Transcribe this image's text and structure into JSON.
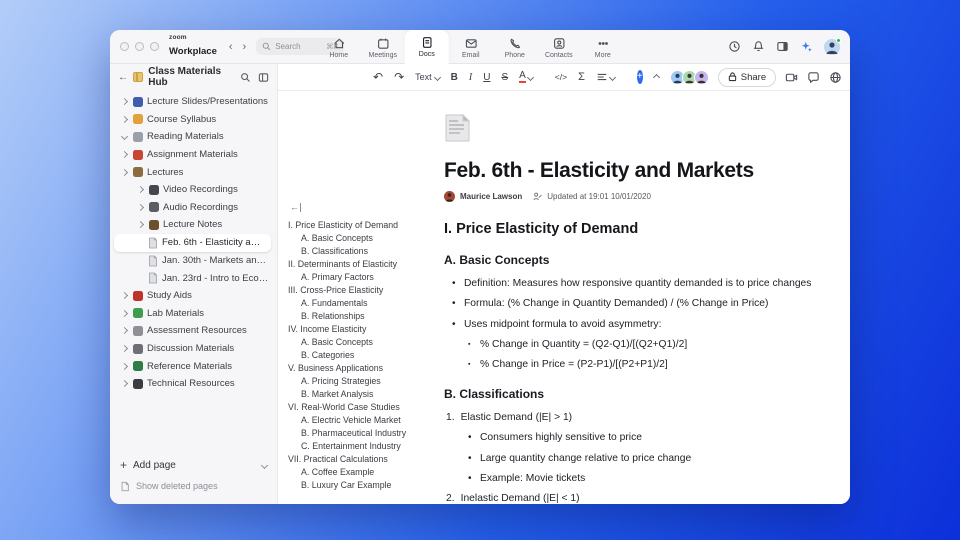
{
  "colors": {
    "accent_blue": "#2e6bf0",
    "background_gradient_start": "#b3cdf8",
    "background_gradient_end": "#0c2fd9",
    "presence_green": "#2fb24c"
  },
  "titlebar": {
    "brand_top": "zoom",
    "brand_bottom": "Workplace",
    "search": {
      "placeholder": "Search",
      "shortcut": "⌘F"
    },
    "nav": [
      {
        "label": "Home",
        "icon": "home-icon",
        "active": false
      },
      {
        "label": "Meetings",
        "icon": "meetings-icon",
        "active": false
      },
      {
        "label": "Docs",
        "icon": "docs-icon",
        "active": true
      },
      {
        "label": "Email",
        "icon": "email-icon",
        "active": false
      },
      {
        "label": "Phone",
        "icon": "phone-icon",
        "active": false
      },
      {
        "label": "Contacts",
        "icon": "contacts-icon",
        "active": false
      },
      {
        "label": "More",
        "icon": "more-icon",
        "active": false
      }
    ]
  },
  "sidebar": {
    "title": "Class Materials Hub",
    "items": [
      {
        "label": "Lecture Slides/Presentations",
        "level": 0,
        "chevron": "right",
        "icon": "presentation-icon",
        "color": "#3f5fae",
        "selected": false
      },
      {
        "label": "Course Syllabus",
        "level": 0,
        "chevron": "right",
        "icon": "syllabus-icon",
        "color": "#e2a23b",
        "selected": false
      },
      {
        "label": "Reading Materials",
        "level": 0,
        "chevron": "down",
        "icon": "book-icon",
        "color": "#9aa0a8",
        "selected": false
      },
      {
        "label": "Assignment Materials",
        "level": 0,
        "chevron": "right",
        "icon": "backpack-icon",
        "color": "#c74634",
        "selected": false
      },
      {
        "label": "Lectures",
        "level": 0,
        "chevron": "right",
        "icon": "lecture-icon",
        "color": "#8a6d3b",
        "selected": false
      },
      {
        "label": "Video Recordings",
        "level": 1,
        "chevron": "right",
        "icon": "video-icon",
        "color": "#44474d",
        "selected": false
      },
      {
        "label": "Audio Recordings",
        "level": 1,
        "chevron": "right",
        "icon": "audio-icon",
        "color": "#5a5d63",
        "selected": false
      },
      {
        "label": "Lecture Notes",
        "level": 1,
        "chevron": "right",
        "icon": "notes-icon",
        "color": "#6b4f2f",
        "selected": false
      },
      {
        "label": "Feb. 6th - Elasticity and M...",
        "level": 2,
        "chevron": null,
        "icon": "page-icon",
        "color": null,
        "selected": true
      },
      {
        "label": "Jan. 30th - Markets and P...",
        "level": 2,
        "chevron": null,
        "icon": "page-icon",
        "color": null,
        "selected": false
      },
      {
        "label": "Jan. 23rd - Intro to Econo...",
        "level": 2,
        "chevron": null,
        "icon": "page-icon",
        "color": null,
        "selected": false
      },
      {
        "label": "Study Aids",
        "level": 0,
        "chevron": "right",
        "icon": "apple-icon",
        "color": "#c0332b",
        "selected": false
      },
      {
        "label": "Lab Materials",
        "level": 0,
        "chevron": "right",
        "icon": "lab-icon",
        "color": "#3f9e4d",
        "selected": false
      },
      {
        "label": "Assessment Resources",
        "level": 0,
        "chevron": "right",
        "icon": "assessment-icon",
        "color": "#8e9096",
        "selected": false
      },
      {
        "label": "Discussion Materials",
        "level": 0,
        "chevron": "right",
        "icon": "discussion-icon",
        "color": "#6d6f75",
        "selected": false
      },
      {
        "label": "Reference Materials",
        "level": 0,
        "chevron": "right",
        "icon": "reference-icon",
        "color": "#2f7d46",
        "selected": false
      },
      {
        "label": "Technical Resources",
        "level": 0,
        "chevron": "right",
        "icon": "tech-icon",
        "color": "#3a3c41",
        "selected": false
      }
    ],
    "add_page_label": "Add page",
    "show_deleted_label": "Show deleted pages"
  },
  "toolbar": {
    "text_style_label": "Text",
    "bold": "B",
    "italic": "I",
    "underline": "U",
    "strike": "S",
    "color_letter": "A",
    "code_label": "</>",
    "formula_label": "Σ",
    "share_label": "Share",
    "collaborator_colors": [
      "#9ec9f5",
      "#a8dbb0",
      "#c6b5ee"
    ]
  },
  "outline": {
    "items": [
      {
        "label": "I. Price Elasticity of Demand",
        "level": 0
      },
      {
        "label": "A. Basic Concepts",
        "level": 1
      },
      {
        "label": "B. Classifications",
        "level": 1
      },
      {
        "label": "II. Determinants of Elasticity",
        "level": 0
      },
      {
        "label": "A. Primary Factors",
        "level": 1
      },
      {
        "label": "III. Cross-Price Elasticity",
        "level": 0
      },
      {
        "label": "A. Fundamentals",
        "level": 1
      },
      {
        "label": "B. Relationships",
        "level": 1
      },
      {
        "label": "IV. Income Elasticity",
        "level": 0
      },
      {
        "label": "A. Basic Concepts",
        "level": 1
      },
      {
        "label": "B. Categories",
        "level": 1
      },
      {
        "label": "V. Business Applications",
        "level": 0
      },
      {
        "label": "A. Pricing Strategies",
        "level": 1
      },
      {
        "label": "B. Market Analysis",
        "level": 1
      },
      {
        "label": "VI. Real-World Case Studies",
        "level": 0
      },
      {
        "label": "A. Electric Vehicle Market",
        "level": 1
      },
      {
        "label": "B. Pharmaceutical Industry",
        "level": 1
      },
      {
        "label": "C. Entertainment Industry",
        "level": 1
      },
      {
        "label": "VII. Practical Calculations",
        "level": 0
      },
      {
        "label": "A. Coffee Example",
        "level": 1
      },
      {
        "label": "B. Luxury Car Example",
        "level": 1
      }
    ]
  },
  "doc": {
    "title": "Feb. 6th - Elasticity and Markets",
    "author": "Maurice Lawson",
    "updated": "Updated at 19:01 10/01/2020",
    "blocks": [
      {
        "type": "h2",
        "text": "I. Price Elasticity of Demand"
      },
      {
        "type": "h3",
        "text": "A. Basic Concepts"
      },
      {
        "type": "li",
        "marker": "•",
        "level": 0,
        "text": "Definition: Measures how responsive quantity demanded is to price changes"
      },
      {
        "type": "li",
        "marker": "•",
        "level": 0,
        "text": "Formula: (% Change in Quantity Demanded) / (% Change in Price)"
      },
      {
        "type": "li",
        "marker": "•",
        "level": 0,
        "text": "Uses midpoint formula to avoid asymmetry:"
      },
      {
        "type": "li",
        "marker": "▪",
        "level": 1,
        "text": "% Change in Quantity = (Q2-Q1)/[(Q2+Q1)/2]"
      },
      {
        "type": "li",
        "marker": "▪",
        "level": 1,
        "text": "% Change in Price = (P2-P1)/[(P2+P1)/2]"
      },
      {
        "type": "h3",
        "text": "B. Classifications"
      },
      {
        "type": "li",
        "marker": "1.",
        "level": 0,
        "text": "Elastic Demand (|E| > 1)"
      },
      {
        "type": "li",
        "marker": "•",
        "level": 1,
        "text": "Consumers highly sensitive to price"
      },
      {
        "type": "li",
        "marker": "•",
        "level": 1,
        "text": "Large quantity change relative to price change"
      },
      {
        "type": "li",
        "marker": "•",
        "level": 1,
        "text": "Example: Movie tickets"
      },
      {
        "type": "li",
        "marker": "2.",
        "level": 0,
        "text": "Inelastic Demand (|E| < 1)"
      }
    ]
  }
}
